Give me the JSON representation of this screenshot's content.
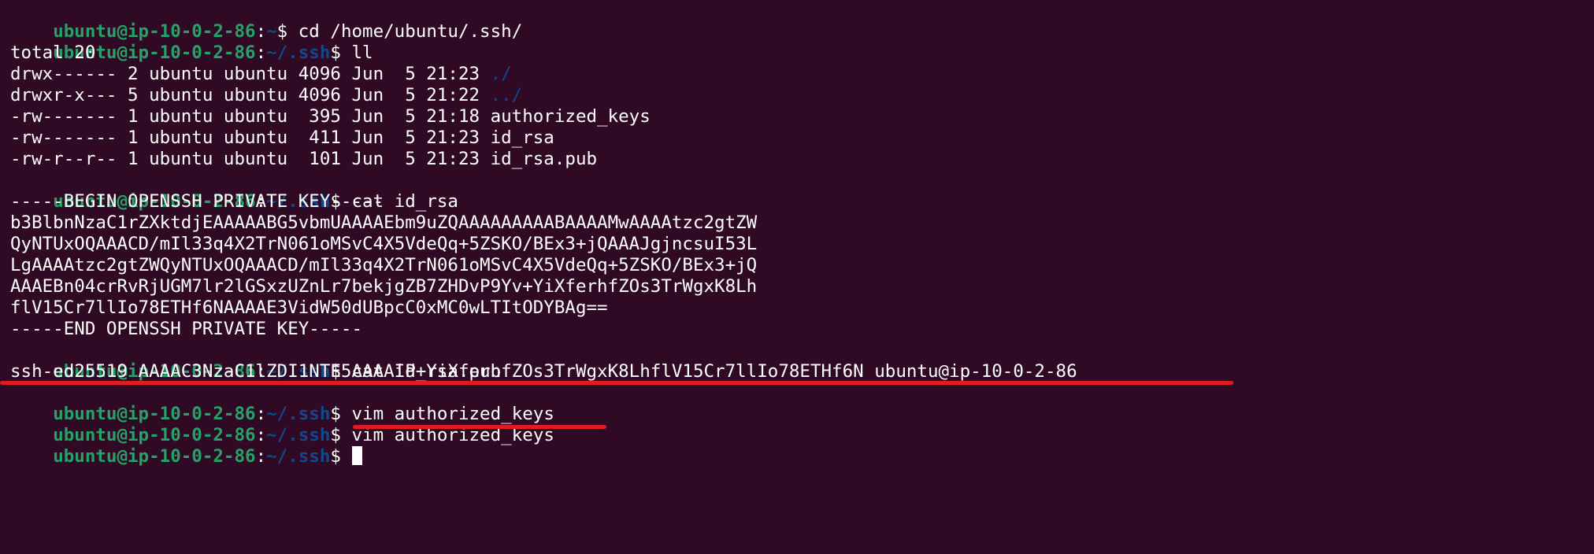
{
  "prompt": {
    "user_host": "ubuntu@ip-10-0-2-86",
    "colon": ":",
    "home_path": "~",
    "ssh_path": "~/.ssh",
    "dollar": "$ "
  },
  "lines": {
    "l1_cmd": "cd /home/ubuntu/.ssh/",
    "l2_cmd": "ll",
    "l3": "total 20",
    "l4_text": "drwx------ 2 ubuntu ubuntu 4096 Jun  5 21:23 ",
    "l4_dir": "./",
    "l5_text": "drwxr-x--- 5 ubuntu ubuntu 4096 Jun  5 21:22 ",
    "l5_dir": "../",
    "l6": "-rw------- 1 ubuntu ubuntu  395 Jun  5 21:18 authorized_keys",
    "l7": "-rw------- 1 ubuntu ubuntu  411 Jun  5 21:23 id_rsa",
    "l8": "-rw-r--r-- 1 ubuntu ubuntu  101 Jun  5 21:23 id_rsa.pub",
    "l9_cmd": "cat id_rsa",
    "l10": "-----BEGIN OPENSSH PRIVATE KEY-----",
    "l11": "b3BlbnNzaC1rZXktdjEAAAAABG5vbmUAAAAEbm9uZQAAAAAAAAABAAAAMwAAAAtzc2gtZW",
    "l12": "QyNTUxOQAAACD/mIl33q4X2TrN061oMSvC4X5VdeQq+5ZSKO/BEx3+jQAAAJgjncsuI53L",
    "l13": "LgAAAAtzc2gtZWQyNTUxOQAAACD/mIl33q4X2TrN061oMSvC4X5VdeQq+5ZSKO/BEx3+jQ",
    "l14": "AAAEBn04crRvRjUGM7lr2lGSxzUZnLr7bekjgZB7ZHDvP9Yv+YiXferhfZOs3TrWgxK8Lh",
    "l15": "flV15Cr7llIo78ETHf6NAAAAE3VidW50dUBpcC0xMC0wLTItODYBAg==",
    "l16": "-----END OPENSSH PRIVATE KEY-----",
    "l17_cmd": "cat id_rsa.pub",
    "l18": "ssh-ed25519 AAAAC3NzaC1lZDI1NTE5AAAAIP+YiXferhfZOs3TrWgxK8LhflV15Cr7llIo78ETHf6N ubuntu@ip-10-0-2-86",
    "l19_cmd": "vim authorized_keys",
    "l20_cmd": "vim authorized_keys"
  },
  "colors": {
    "background": "#300a24",
    "prompt_user": "#26a269",
    "prompt_path": "#12488b",
    "annotation_underline": "#e01b24"
  }
}
